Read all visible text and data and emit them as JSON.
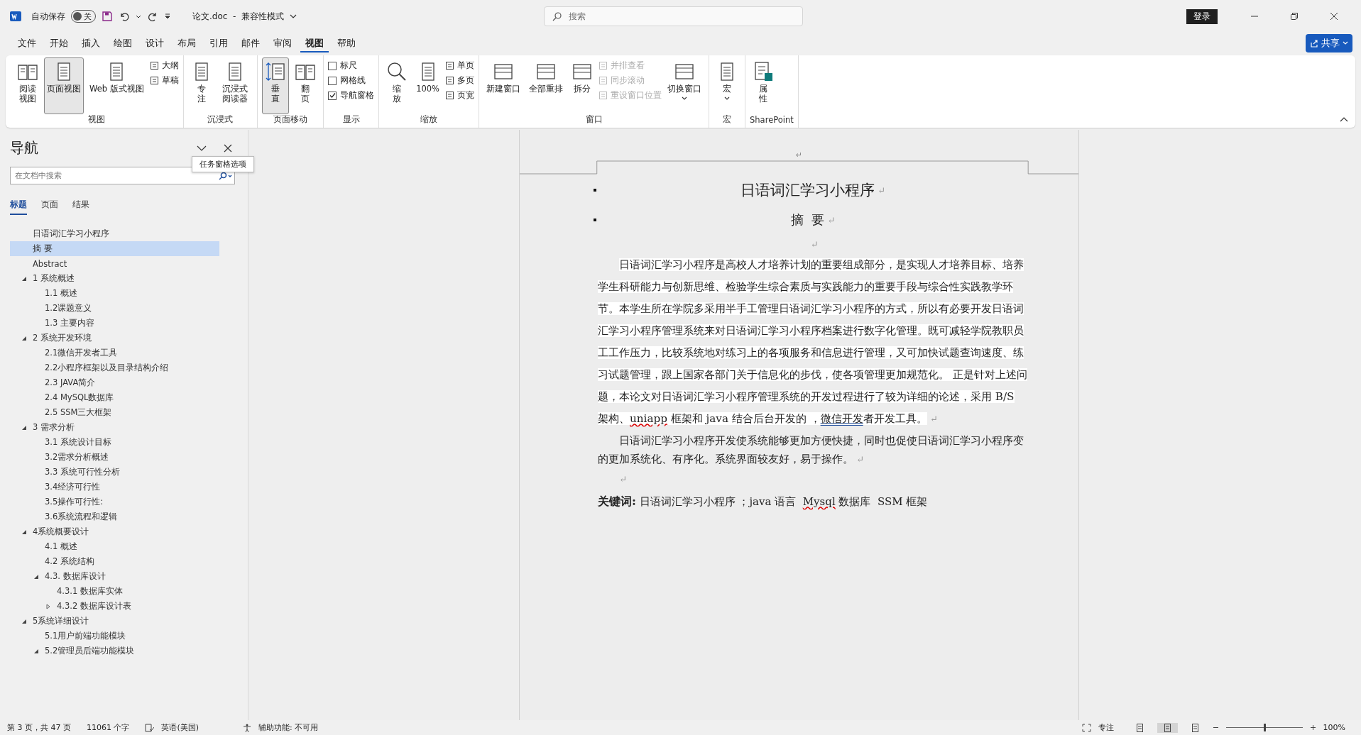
{
  "titlebar": {
    "autosave_label": "自动保存",
    "autosave": {
      "on": false,
      "label": "关"
    },
    "title": "论文.doc  -  兼容性模式",
    "search": {
      "placeholder": "搜索"
    },
    "signin": "登录"
  },
  "menu_tabs": [
    {
      "label": "文件",
      "selected": false
    },
    {
      "label": "开始",
      "selected": false
    },
    {
      "label": "插入",
      "selected": false
    },
    {
      "label": "绘图",
      "selected": false
    },
    {
      "label": "设计",
      "selected": false
    },
    {
      "label": "布局",
      "selected": false
    },
    {
      "label": "引用",
      "selected": false
    },
    {
      "label": "邮件",
      "selected": false
    },
    {
      "label": "审阅",
      "selected": false
    },
    {
      "label": "视图",
      "selected": true
    },
    {
      "label": "帮助",
      "selected": false
    }
  ],
  "share_button": "共享",
  "ribbon": [
    {
      "label": "视图",
      "items": [
        {
          "kind": "large",
          "label": "阅读视图",
          "wrap": true,
          "selected": false
        },
        {
          "kind": "large",
          "label": "页面视图",
          "selected": true
        },
        {
          "kind": "large",
          "label": "Web 版式视图",
          "selected": false
        },
        {
          "kind": "small",
          "label": "大纲",
          "disabled": false
        },
        {
          "kind": "small",
          "label": "草稿",
          "disabled": false
        }
      ]
    },
    {
      "label": "沉浸式",
      "items": [
        {
          "kind": "large",
          "label": "专注",
          "wrap": true,
          "selected": false
        },
        {
          "kind": "large",
          "label": "沉浸式阅读器",
          "wrap": true,
          "selected": false
        }
      ]
    },
    {
      "label": "页面移动",
      "items": [
        {
          "kind": "large",
          "label": "垂直",
          "wrap": true,
          "selected": true
        },
        {
          "kind": "large",
          "label": "翻页",
          "wrap": true,
          "selected": false
        }
      ]
    },
    {
      "label": "显示",
      "items": [
        {
          "kind": "check",
          "label": "标尺",
          "checked": false
        },
        {
          "kind": "check",
          "label": "网格线",
          "checked": false
        },
        {
          "kind": "check",
          "label": "导航窗格",
          "checked": true
        }
      ]
    },
    {
      "label": "缩放",
      "items": [
        {
          "kind": "large",
          "label": "缩放",
          "wrap": true,
          "selected": false
        },
        {
          "kind": "large",
          "label": "100%",
          "selected": false
        },
        {
          "kind": "small",
          "label": "单页",
          "disabled": false
        },
        {
          "kind": "small",
          "label": "多页",
          "disabled": false
        },
        {
          "kind": "small",
          "label": "页宽",
          "disabled": false
        }
      ]
    },
    {
      "label": "窗口",
      "items": [
        {
          "kind": "large",
          "label": "新建窗口",
          "selected": false
        },
        {
          "kind": "large",
          "label": "全部重排",
          "selected": false
        },
        {
          "kind": "large",
          "label": "拆分",
          "selected": false
        },
        {
          "kind": "small",
          "label": "并排查看",
          "disabled": true
        },
        {
          "kind": "small",
          "label": "同步滚动",
          "disabled": true
        },
        {
          "kind": "small",
          "label": "重设窗口位置",
          "disabled": true
        },
        {
          "kind": "large",
          "label": "切换窗口",
          "selected": false,
          "dropdown": true
        }
      ]
    },
    {
      "label": "宏",
      "items": [
        {
          "kind": "large",
          "label": "宏",
          "selected": false,
          "dropdown": true
        }
      ]
    },
    {
      "label": "SharePoint",
      "items": [
        {
          "kind": "large",
          "label": "属性",
          "wrap": true,
          "selected": false
        }
      ]
    }
  ],
  "navigation": {
    "title": "导航",
    "search": {
      "placeholder": "在文档中搜索"
    },
    "tooltip": "任务窗格选项",
    "tabs": [
      {
        "label": "标题",
        "selected": true
      },
      {
        "label": "页面",
        "selected": false
      },
      {
        "label": "结果",
        "selected": false
      }
    ],
    "headings": [
      {
        "label": "日语词汇学习小程序",
        "selected": false
      },
      {
        "label": "摘 要",
        "selected": true
      },
      {
        "label": "Abstract",
        "selected": false
      },
      {
        "label": "1 系统概述",
        "selected": false,
        "expanded": true,
        "children": [
          {
            "label": "1.1 概述",
            "selected": false
          },
          {
            "label": "1.2课题意义",
            "selected": false
          },
          {
            "label": "1.3 主要内容",
            "selected": false
          }
        ]
      },
      {
        "label": "2 系统开发环境",
        "selected": false,
        "expanded": true,
        "children": [
          {
            "label": "2.1微信开发者工具",
            "selected": false
          },
          {
            "label": "2.2小程序框架以及目录结构介绍",
            "selected": false
          },
          {
            "label": "2.3 JAVA简介",
            "selected": false
          },
          {
            "label": "2.4 MySQL数据库",
            "selected": false
          },
          {
            "label": "2.5 SSM三大框架",
            "selected": false
          }
        ]
      },
      {
        "label": "3 需求分析",
        "selected": false,
        "expanded": true,
        "children": [
          {
            "label": "3.1 系统设计目标",
            "selected": false
          },
          {
            "label": "3.2需求分析概述",
            "selected": false
          },
          {
            "label": "3.3 系统可行性分析",
            "selected": false
          },
          {
            "label": "3.4经济可行性",
            "selected": false
          },
          {
            "label": "3.5操作可行性:",
            "selected": false
          },
          {
            "label": "3.6系统流程和逻辑",
            "selected": false
          }
        ]
      },
      {
        "label": "4系统概要设计",
        "selected": false,
        "expanded": true,
        "children": [
          {
            "label": "4.1 概述",
            "selected": false
          },
          {
            "label": "4.2 系统结构",
            "selected": false
          },
          {
            "label": "4.3. 数据库设计",
            "selected": false,
            "expanded": true,
            "children": [
              {
                "label": "4.3.1 数据库实体",
                "selected": false
              },
              {
                "label": "4.3.2 数据库设计表",
                "selected": false,
                "expanded": false
              }
            ]
          }
        ]
      },
      {
        "label": "5系统详细设计",
        "selected": false,
        "expanded": true,
        "children": [
          {
            "label": "5.1用户前端功能模块",
            "selected": false
          },
          {
            "label": "5.2管理员后端功能模块",
            "selected": false,
            "expanded": true
          }
        ]
      }
    ]
  },
  "document": {
    "header_mark": "↵",
    "blocks": [
      {
        "kind": "title",
        "text": "日语词汇学习小程序",
        "pilcrow": "↵"
      },
      {
        "kind": "heading",
        "text": "摘  要",
        "pilcrow": "↵"
      },
      {
        "kind": "empty",
        "pilcrow": "↵"
      },
      {
        "kind": "body",
        "shaded": true,
        "segments": [
          {
            "text": "日语词汇学习小程序是高校人才培养计划的重要组成部分，是实现人才培养目标、培养学生科研能力与创新思维、检验学生综合素质与实践能力的重要手段与综合性实践教学环节。本学生所在学院多采用半手工管理日语词汇学习小程序的方式，所以有必要开发日语词汇学习小程序管理系统来对日语词汇学习小程序档案进行数字化管理。既可减轻学院教职员工工作压力，比较系统地对练习上的各项服务和信息进行管理，又可加快试题查询速度、练习试题管理，跟上国家各部门关于信息化的步伐，使各项管理更加规范化。  正是针对上述问题，本论文对日语词汇学习小程序管理系统的开发过程进行了较为详细的论述，采用 B/S 架构、"
          },
          {
            "text": "uniapp",
            "kind": "spelling"
          },
          {
            "text": " 框架和 java 结合后台开发的 ，"
          },
          {
            "text": "微信开发",
            "kind": "grammar"
          },
          {
            "text": "者开发工具。"
          }
        ],
        "pilcrow": "↵"
      },
      {
        "kind": "body",
        "shaded": false,
        "segments": [
          {
            "text": "日语词汇学习小程序开发使系统能够更加方便快捷，同时也促使日语词汇学习小程序变的更加系统化、有序化。系统界面较友好，易于操作。"
          }
        ],
        "pilcrow": "↵"
      },
      {
        "kind": "indent-empty",
        "pilcrow": "↵"
      },
      {
        "kind": "keywords",
        "segments": [
          {
            "text": "关键词:",
            "kind": "bold"
          },
          {
            "text": " 日语词汇学习小程序 ；java 语言  "
          },
          {
            "text": "Mysql",
            "kind": "spelling"
          },
          {
            "text": " 数据库  SSM 框架"
          }
        ]
      }
    ]
  },
  "status_bar": {
    "page": "第 3 页，共 47 页",
    "words": "11061 个字",
    "language": "英语(美国)",
    "accessibility": "辅助功能: 不可用",
    "focus": "专注",
    "views": [
      {
        "selected": false
      },
      {
        "selected": true
      },
      {
        "selected": false
      }
    ],
    "zoom": {
      "level": 0.5,
      "reading": "100%"
    }
  }
}
